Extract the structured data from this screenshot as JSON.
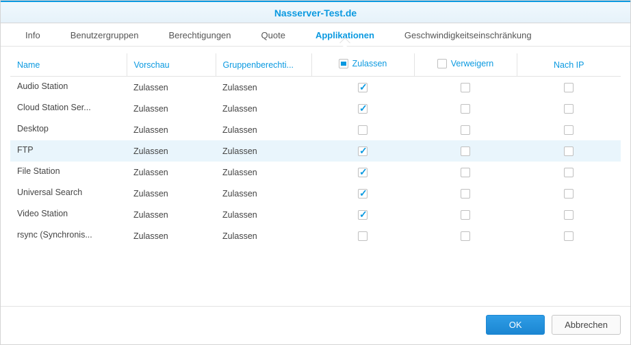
{
  "window": {
    "title": "Nasserver-Test.de"
  },
  "tabs": [
    {
      "label": "Info",
      "active": false
    },
    {
      "label": "Benutzergruppen",
      "active": false
    },
    {
      "label": "Berechtigungen",
      "active": false
    },
    {
      "label": "Quote",
      "active": false
    },
    {
      "label": "Applikationen",
      "active": true
    },
    {
      "label": "Geschwindigkeitseinschränkung",
      "active": false
    }
  ],
  "columns": {
    "name": "Name",
    "vorschau": "Vorschau",
    "gruppe": "Gruppenberechti...",
    "zulassen": "Zulassen",
    "verweigern": "Verweigern",
    "ip": "Nach IP"
  },
  "header_allow_state": "partial",
  "rows": [
    {
      "name": "Audio Station",
      "vorschau": "Zulassen",
      "gruppe": "Zulassen",
      "allow": true,
      "deny": false,
      "ip": false,
      "highlight": false
    },
    {
      "name": "Cloud Station Ser...",
      "vorschau": "Zulassen",
      "gruppe": "Zulassen",
      "allow": true,
      "deny": false,
      "ip": false,
      "highlight": false
    },
    {
      "name": "Desktop",
      "vorschau": "Zulassen",
      "gruppe": "Zulassen",
      "allow": false,
      "deny": false,
      "ip": false,
      "highlight": false
    },
    {
      "name": "FTP",
      "vorschau": "Zulassen",
      "gruppe": "Zulassen",
      "allow": true,
      "deny": false,
      "ip": false,
      "highlight": true
    },
    {
      "name": "File Station",
      "vorschau": "Zulassen",
      "gruppe": "Zulassen",
      "allow": true,
      "deny": false,
      "ip": false,
      "highlight": false
    },
    {
      "name": "Universal Search",
      "vorschau": "Zulassen",
      "gruppe": "Zulassen",
      "allow": true,
      "deny": false,
      "ip": false,
      "highlight": false
    },
    {
      "name": "Video Station",
      "vorschau": "Zulassen",
      "gruppe": "Zulassen",
      "allow": true,
      "deny": false,
      "ip": false,
      "highlight": false
    },
    {
      "name": "rsync (Synchronis...",
      "vorschau": "Zulassen",
      "gruppe": "Zulassen",
      "allow": false,
      "deny": false,
      "ip": false,
      "highlight": false
    }
  ],
  "footer": {
    "ok": "OK",
    "cancel": "Abbrechen"
  }
}
